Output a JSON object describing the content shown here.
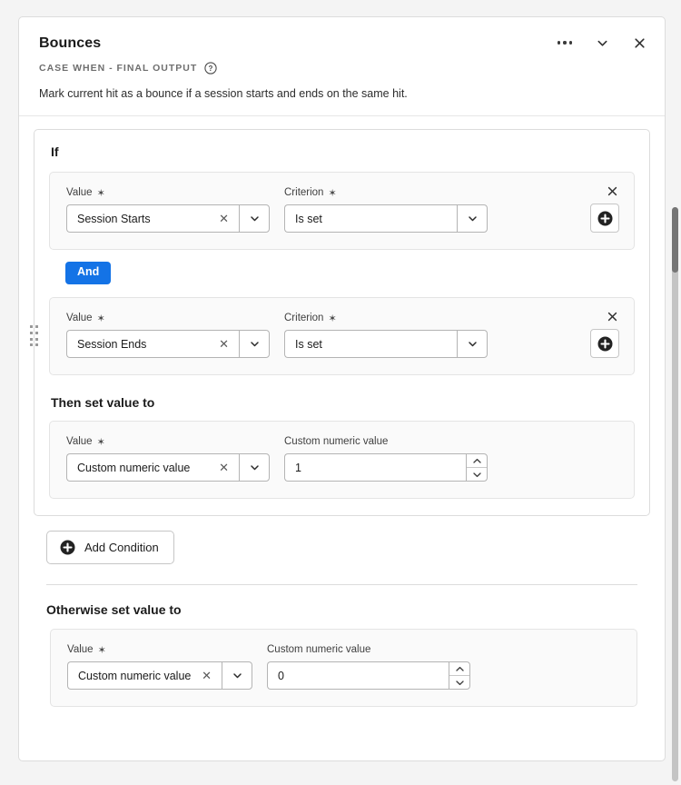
{
  "panel": {
    "title": "Bounces",
    "eyebrow": "CASE WHEN - FINAL OUTPUT",
    "help_icon": "help-circle-icon",
    "description": "Mark current hit as a bounce if a session starts and ends on the same hit.",
    "actions": {
      "more": "more-options-icon",
      "collapse": "chevron-down-icon",
      "close": "close-icon"
    }
  },
  "if_section": {
    "title": "If",
    "conditions": [
      {
        "value_label": "Value",
        "value_required": "✶",
        "value": "Session Starts",
        "clear": "✕",
        "criterion_label": "Criterion",
        "criterion_required": "✶",
        "criterion": "Is set",
        "remove": "✕",
        "add": "add-circle-icon"
      },
      {
        "value_label": "Value",
        "value_required": "✶",
        "value": "Session Ends",
        "clear": "✕",
        "criterion_label": "Criterion",
        "criterion_required": "✶",
        "criterion": "Is set",
        "remove": "✕",
        "add": "add-circle-icon",
        "drag": "drag-handle-icon"
      }
    ],
    "operator_badge": "And",
    "then": {
      "title": "Then set value to",
      "value_label": "Value",
      "value_required": "✶",
      "value": "Custom numeric value",
      "clear": "✕",
      "numeric_label": "Custom numeric value",
      "numeric_value": "1",
      "increment": "stepper-up-icon",
      "decrement": "stepper-down-icon"
    }
  },
  "add_condition": {
    "label": "Add Condition",
    "icon": "add-circle-icon"
  },
  "otherwise_section": {
    "title": "Otherwise set value to",
    "value_label": "Value",
    "value_required": "✶",
    "value": "Custom numeric value",
    "clear": "✕",
    "numeric_label": "Custom numeric value",
    "numeric_value": "0",
    "increment": "stepper-up-icon",
    "decrement": "stepper-down-icon"
  },
  "colors": {
    "accent_blue": "#1473e6",
    "panel_bg": "#fafafa",
    "border": "#dcdcdc",
    "page_bg": "#f4f4f4"
  }
}
